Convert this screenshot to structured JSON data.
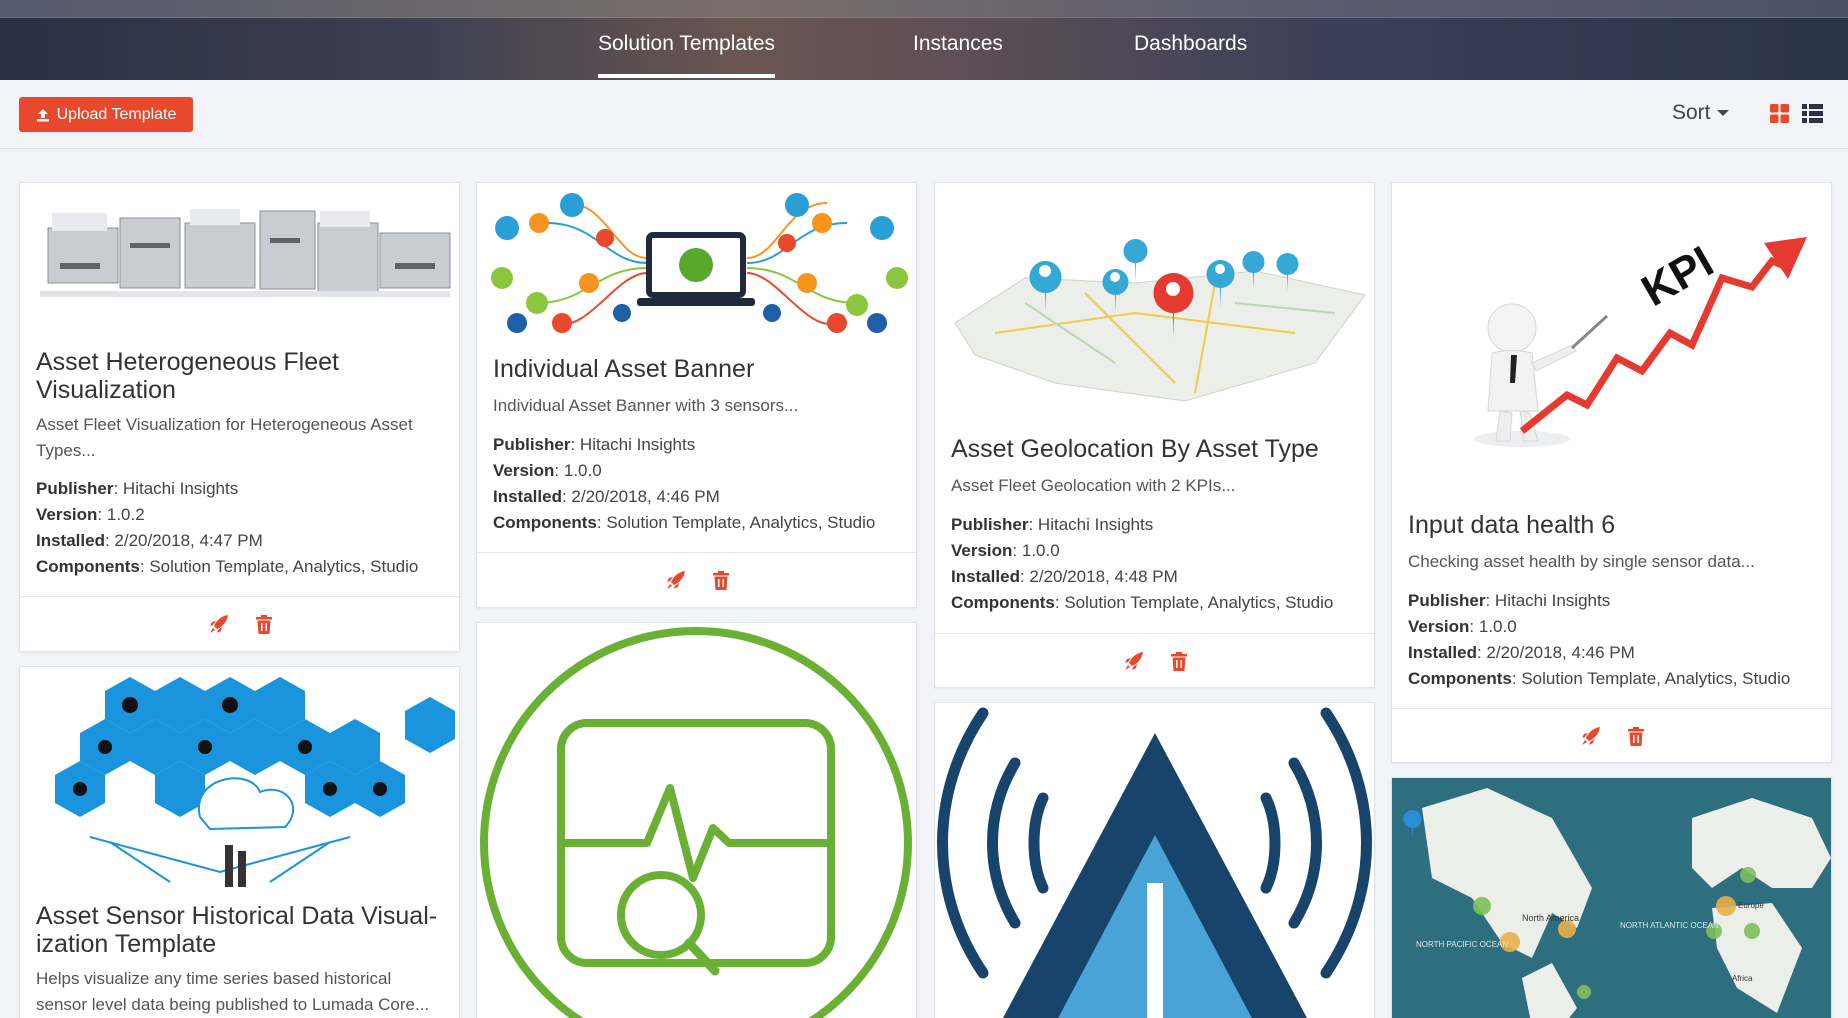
{
  "nav": {
    "tabs": [
      {
        "label": "Solution Templates",
        "active": true
      },
      {
        "label": "Instances",
        "active": false
      },
      {
        "label": "Dashboards",
        "active": false
      }
    ]
  },
  "toolbar": {
    "upload_label": "Upload Template",
    "sort_label": "Sort",
    "grid_view_icon": "grid-view-icon",
    "list_view_icon": "list-view-icon"
  },
  "labels": {
    "publisher": "Publisher",
    "version": "Version",
    "installed": "Installed",
    "components": "Components"
  },
  "cards": [
    {
      "title": "Asset Heterogeneous Fleet Visualization",
      "description": "Asset Fleet Visualization for Heterogeneous Asset Types...",
      "publisher": "Hitachi Insights",
      "version": "1.0.2",
      "installed": "2/20/2018, 4:47 PM",
      "components": "Solution Template, Analytics, Studio",
      "image": "printers-photo"
    },
    {
      "title": "Individual Asset Banner",
      "description": "Individual Asset Banner with 3 sensors...",
      "publisher": "Hitachi Insights",
      "version": "1.0.0",
      "installed": "2/20/2018, 4:46 PM",
      "components": "Solution Template, Analytics, Studio",
      "image": "laptop-network-illustration"
    },
    {
      "title": "Asset Geolocation By Asset Type",
      "description": "Asset Fleet Geolocation with 2 KPIs...",
      "publisher": "Hitachi Insights",
      "version": "1.0.0",
      "installed": "2/20/2018, 4:48 PM",
      "components": "Solution Template, Analytics, Studio",
      "image": "map-pins-illustration"
    },
    {
      "title": "Input data health 6",
      "description": "Checking asset health by single sensor data...",
      "publisher": "Hitachi Insights",
      "version": "1.0.0",
      "installed": "2/20/2018, 4:46 PM",
      "components": "Solution Template, Analytics, Studio",
      "image": "kpi-chart-illustration"
    },
    {
      "title": "Asset Sensor Historical Data Visual-ization Template",
      "description": "Helps visualize any time series based historical sensor level data being published to Lumada Core...",
      "image": "iot-hexagon-illustration"
    },
    {
      "image": "monitor-search-icon-illustration"
    },
    {
      "image": "signal-warning-illustration"
    },
    {
      "image": "world-map-illustration",
      "map_labels": [
        "North America",
        "NORTH ATLANTIC OCEAN",
        "NORTH PACIFIC OCEAN",
        "Europe",
        "Africa"
      ]
    }
  ],
  "colors": {
    "accent": "#e8482b",
    "nav_bg": "#2b3348"
  }
}
